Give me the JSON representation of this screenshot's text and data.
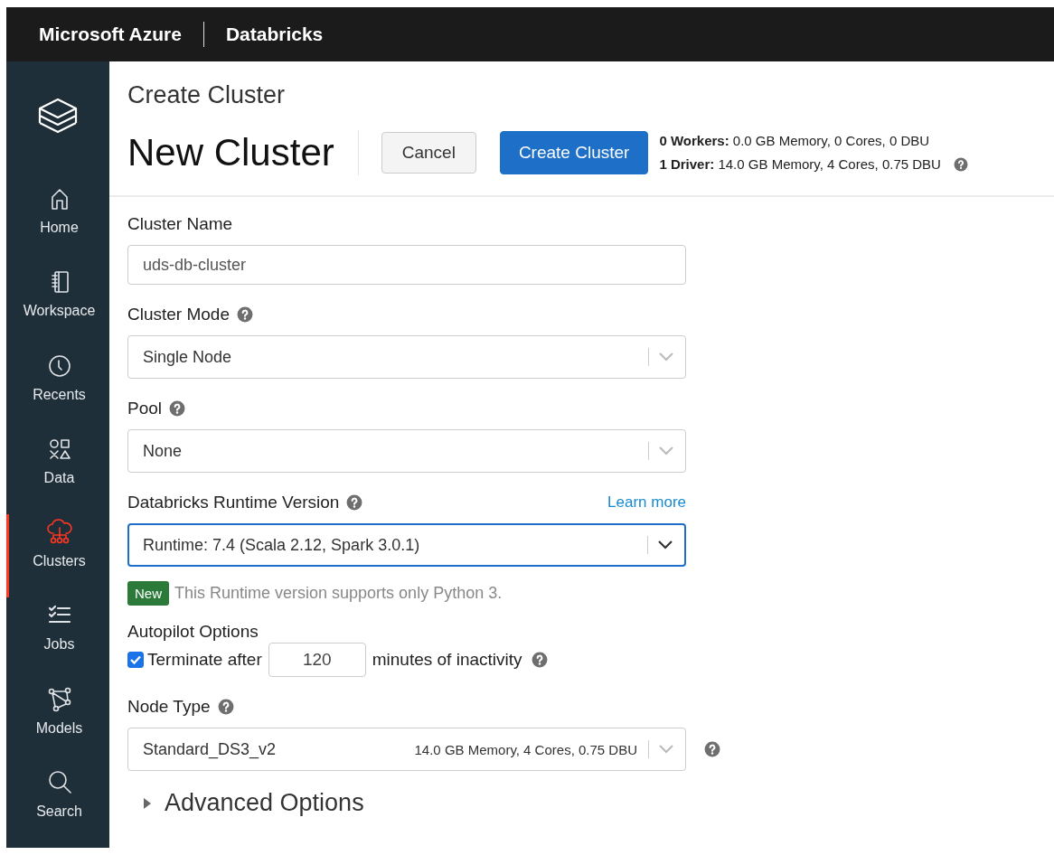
{
  "header": {
    "brand": "Microsoft Azure",
    "product": "Databricks"
  },
  "sidebar": {
    "items": [
      {
        "label": "Home",
        "selected": false
      },
      {
        "label": "Workspace",
        "selected": false
      },
      {
        "label": "Recents",
        "selected": false
      },
      {
        "label": "Data",
        "selected": false
      },
      {
        "label": "Clusters",
        "selected": true
      },
      {
        "label": "Jobs",
        "selected": false
      },
      {
        "label": "Models",
        "selected": false
      },
      {
        "label": "Search",
        "selected": false
      }
    ]
  },
  "page": {
    "breadcrumb": "Create Cluster",
    "title": "New Cluster",
    "buttons": [
      {
        "label": "Cancel",
        "kind": "secondary"
      },
      {
        "label": "Create Cluster",
        "kind": "primary"
      }
    ],
    "summary": [
      "**0 Workers:** 0.0 GB Memory, 0 Cores, 0 DBU",
      "**1 Driver:** 14.0 GB Memory, 4 Cores, 0.75 DBU"
    ]
  },
  "fields": [
    {
      "kind": "text",
      "label": "Cluster Name",
      "help": false,
      "value": "uds-db-cluster"
    },
    {
      "kind": "select",
      "label": "Cluster Mode",
      "help": true,
      "value": "Single Node",
      "focused": false
    },
    {
      "kind": "select",
      "label": "Pool",
      "help": true,
      "value": "None",
      "focused": false
    },
    {
      "kind": "select",
      "label": "Databricks Runtime Version",
      "help": true,
      "link": "Learn more",
      "value": "Runtime: 7.4 (Scala 2.12, Spark 3.0.1)",
      "focused": true,
      "note": {
        "badge": "New",
        "text": "This Runtime version supports only Python 3."
      }
    },
    {
      "kind": "autopilot",
      "label": "Autopilot Options",
      "help": true,
      "checked": true,
      "before": "Terminate after",
      "value": "120",
      "after": "minutes of inactivity"
    },
    {
      "kind": "select",
      "label": "Node Type",
      "help": true,
      "value": "Standard_DS3_v2",
      "detail": "14.0 GB Memory, 4 Cores, 0.75 DBU",
      "focused": false,
      "side_help": true
    }
  ],
  "advanced": {
    "label": "Advanced Options",
    "expanded": false
  }
}
